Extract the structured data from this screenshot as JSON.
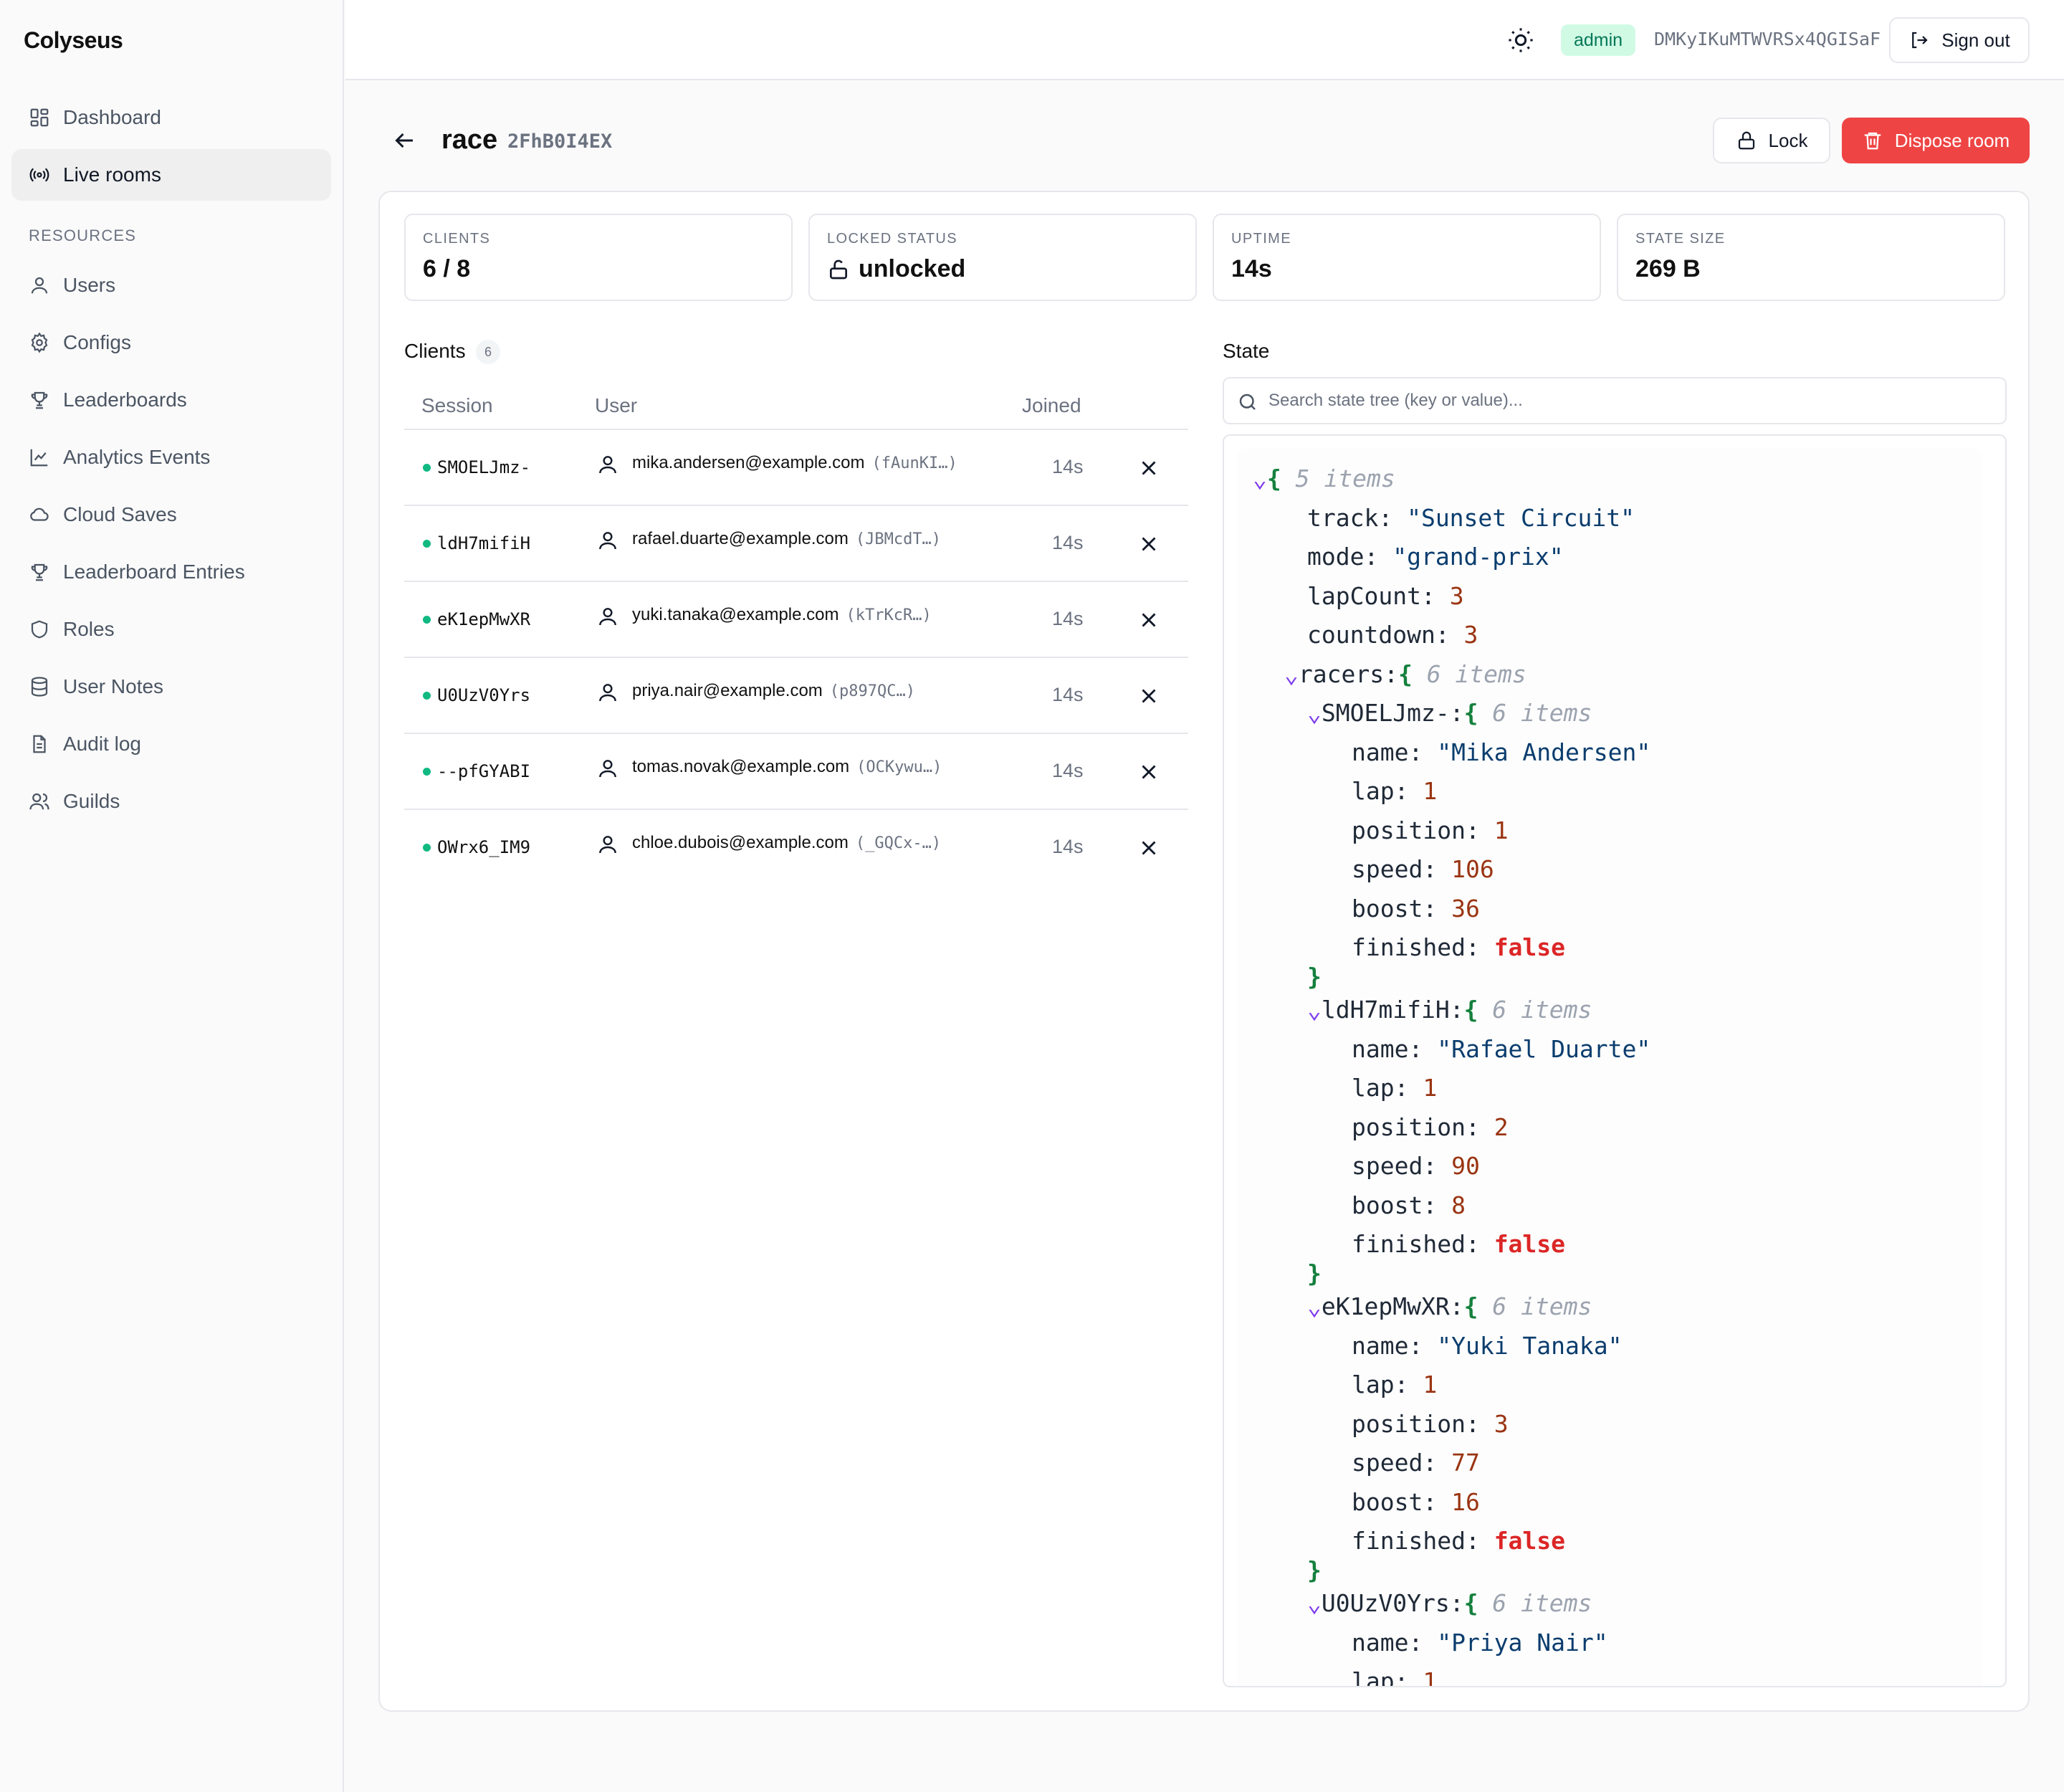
{
  "app": {
    "brand": "Colyseus"
  },
  "sidebar": {
    "items": [
      {
        "label": "Dashboard",
        "icon": "dashboard-icon"
      },
      {
        "label": "Live rooms",
        "icon": "broadcast-icon"
      }
    ],
    "section_label": "RESOURCES",
    "resources": [
      {
        "label": "Users",
        "icon": "user-icon"
      },
      {
        "label": "Configs",
        "icon": "gear-icon"
      },
      {
        "label": "Leaderboards",
        "icon": "trophy-icon"
      },
      {
        "label": "Analytics Events",
        "icon": "chart-line-icon"
      },
      {
        "label": "Cloud Saves",
        "icon": "cloud-icon"
      },
      {
        "label": "Leaderboard Entries",
        "icon": "trophy-icon"
      },
      {
        "label": "Roles",
        "icon": "shield-icon"
      },
      {
        "label": "User Notes",
        "icon": "database-icon"
      },
      {
        "label": "Audit log",
        "icon": "file-icon"
      },
      {
        "label": "Guilds",
        "icon": "users-icon"
      }
    ]
  },
  "header": {
    "role_badge": "admin",
    "token": "DMKyIKuMTWVRSx4QGISaF",
    "sign_out": "Sign out"
  },
  "room": {
    "name": "race",
    "id": "2FhB0I4EX",
    "lock_label": "Lock",
    "dispose_label": "Dispose room"
  },
  "stats": [
    {
      "label": "CLIENTS",
      "value": "6 / 8"
    },
    {
      "label": "LOCKED STATUS",
      "value": "unlocked"
    },
    {
      "label": "UPTIME",
      "value": "14s"
    },
    {
      "label": "STATE SIZE",
      "value": "269 B"
    }
  ],
  "clients": {
    "title": "Clients",
    "count": "6",
    "columns": [
      "Session",
      "User",
      "Joined"
    ],
    "rows": [
      {
        "session": "SMOELJmz-",
        "email": "mika.andersen@example.com",
        "short": "(fAunKI…)",
        "joined": "14s"
      },
      {
        "session": "ldH7mifiH",
        "email": "rafael.duarte@example.com",
        "short": "(JBMcdT…)",
        "joined": "14s"
      },
      {
        "session": "eK1epMwXR",
        "email": "yuki.tanaka@example.com",
        "short": "(kTrKcR…)",
        "joined": "14s"
      },
      {
        "session": "U0UzV0Yrs",
        "email": "priya.nair@example.com",
        "short": "(p897QC…)",
        "joined": "14s"
      },
      {
        "session": "--pfGYABI",
        "email": "tomas.novak@example.com",
        "short": "(OCKywu…)",
        "joined": "14s"
      },
      {
        "session": "OWrx6_IM9",
        "email": "chloe.dubois@example.com",
        "short": "(_GQCx-…)",
        "joined": "14s"
      }
    ]
  },
  "state": {
    "title": "State",
    "search_placeholder": "Search state tree (key or value)...",
    "root_count": "5 items",
    "track": "\"Sunset Circuit\"",
    "mode": "\"grand-prix\"",
    "lapCount": "3",
    "countdown": "3",
    "racers_count": "6 items",
    "racers": [
      {
        "id": "SMOELJmz-",
        "count": "6 items",
        "name": "\"Mika Andersen\"",
        "lap": "1",
        "position": "1",
        "speed": "106",
        "boost": "36",
        "finished": "false"
      },
      {
        "id": "ldH7mifiH",
        "count": "6 items",
        "name": "\"Rafael Duarte\"",
        "lap": "1",
        "position": "2",
        "speed": "90",
        "boost": "8",
        "finished": "false"
      },
      {
        "id": "eK1epMwXR",
        "count": "6 items",
        "name": "\"Yuki Tanaka\"",
        "lap": "1",
        "position": "3",
        "speed": "77",
        "boost": "16",
        "finished": "false"
      },
      {
        "id": "U0UzV0Yrs",
        "count": "6 items",
        "name": "\"Priya Nair\"",
        "lap": "1"
      }
    ]
  },
  "colors": {
    "accent_green": "#10b981",
    "danger": "#ef4444",
    "badge_bg": "#d1fae5",
    "string": "#0b3d6e",
    "number": "#9a3412"
  }
}
